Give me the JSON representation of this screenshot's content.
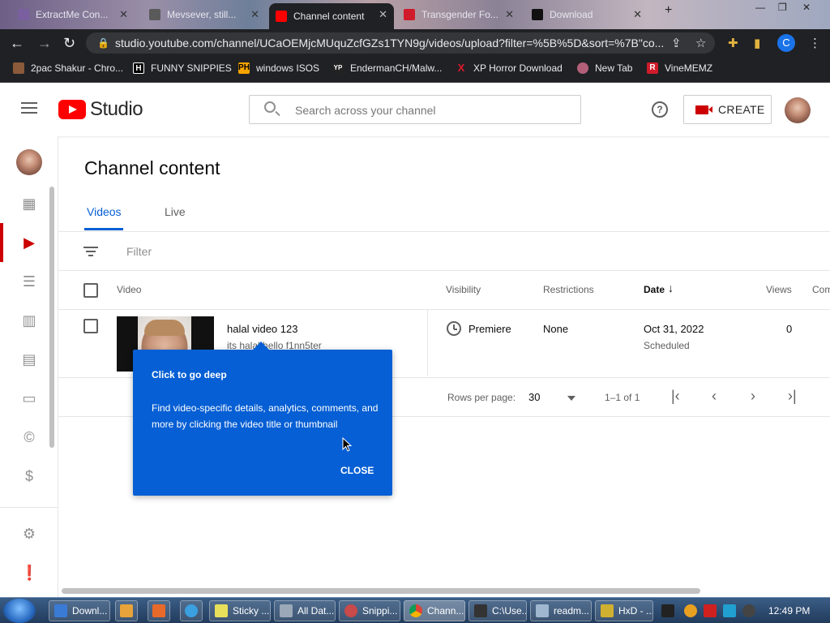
{
  "browser": {
    "tabs": [
      {
        "label": "ExtractMe Con...",
        "color": "#7a5fa0"
      },
      {
        "label": "Mevsever, still...",
        "color": "#5a5a5a"
      },
      {
        "label": "Channel content",
        "color": "#ff0000",
        "active": true
      },
      {
        "label": "Transgender Fo...",
        "color": "#d01b2a"
      },
      {
        "label": "Download",
        "color": "#111111"
      }
    ],
    "url": "studio.youtube.com/channel/UCaOEMjcMUquZcfGZs1TYN9g/videos/upload?filter=%5B%5D&sort=%7B\"co...",
    "profile_initial": "C",
    "bookmarks": [
      {
        "label": "2pac Shakur - Chro...",
        "icon": "photo-icon",
        "color": "#8b5a3a",
        "glyph": ""
      },
      {
        "label": "FUNNY SNIPPIES",
        "icon": "h-icon",
        "color": "#000000",
        "glyph": "H"
      },
      {
        "label": "windows ISOS",
        "icon": "ph-icon",
        "color": "#f7a400",
        "glyph": "PH"
      },
      {
        "label": "EndermanCH/Malw...",
        "icon": "yp-icon",
        "color": "#222222",
        "glyph": "YP"
      },
      {
        "label": "XP Horror Download",
        "icon": "x-icon",
        "color": "#e0192c",
        "glyph": "X"
      },
      {
        "label": "New Tab",
        "icon": "globe-icon",
        "color": "#b35f7a",
        "glyph": ""
      },
      {
        "label": "VineMEMZ",
        "icon": "r-icon",
        "color": "#d01b2a",
        "glyph": "R"
      }
    ]
  },
  "header": {
    "logo_text": "Studio",
    "search_placeholder": "Search across your channel",
    "help_glyph": "?",
    "create_label": "CREATE"
  },
  "page": {
    "title": "Channel content",
    "tabs": [
      "Videos",
      "Live"
    ],
    "active_tab": "Videos",
    "filter_placeholder": "Filter"
  },
  "table": {
    "columns": {
      "video": "Video",
      "visibility": "Visibility",
      "restrictions": "Restrictions",
      "date": "Date",
      "views": "Views",
      "comments": "Com"
    },
    "rows": [
      {
        "title": "halal video 123",
        "description": "its halal hello f1nn5ter",
        "visibility": "Premiere",
        "restrictions": "None",
        "date": "Oct 31, 2022",
        "date_status": "Scheduled",
        "views": "0"
      }
    ],
    "pagination": {
      "rows_per_page_label": "Rows per page:",
      "rows_per_page": "30",
      "range": "1–1 of 1"
    }
  },
  "tooltip": {
    "title": "Click to go deep",
    "body": "Find video-specific details, analytics, comments, and more by clicking the video title or thumbnail",
    "close_label": "CLOSE"
  },
  "taskbar": {
    "items": [
      {
        "label": "Downl...",
        "color": "#3a7bd5"
      },
      {
        "label": "",
        "color": "#e8a33a"
      },
      {
        "label": "",
        "color": "#e86a2a"
      },
      {
        "label": "",
        "color": "#3ba0e0"
      },
      {
        "label": "Sticky ...",
        "color": "#e8e05a"
      },
      {
        "label": "All Dat...",
        "color": "#9aa8b8"
      },
      {
        "label": "Snippi...",
        "color": "#c84a4a"
      },
      {
        "label": "Chann...",
        "color": "#4aa04a"
      },
      {
        "label": "C:\\Use...",
        "color": "#333333"
      },
      {
        "label": "readm...",
        "color": "#9fb8d0"
      },
      {
        "label": "HxD - ...",
        "color": "#d0b030"
      }
    ],
    "clock": "12:49 PM"
  }
}
